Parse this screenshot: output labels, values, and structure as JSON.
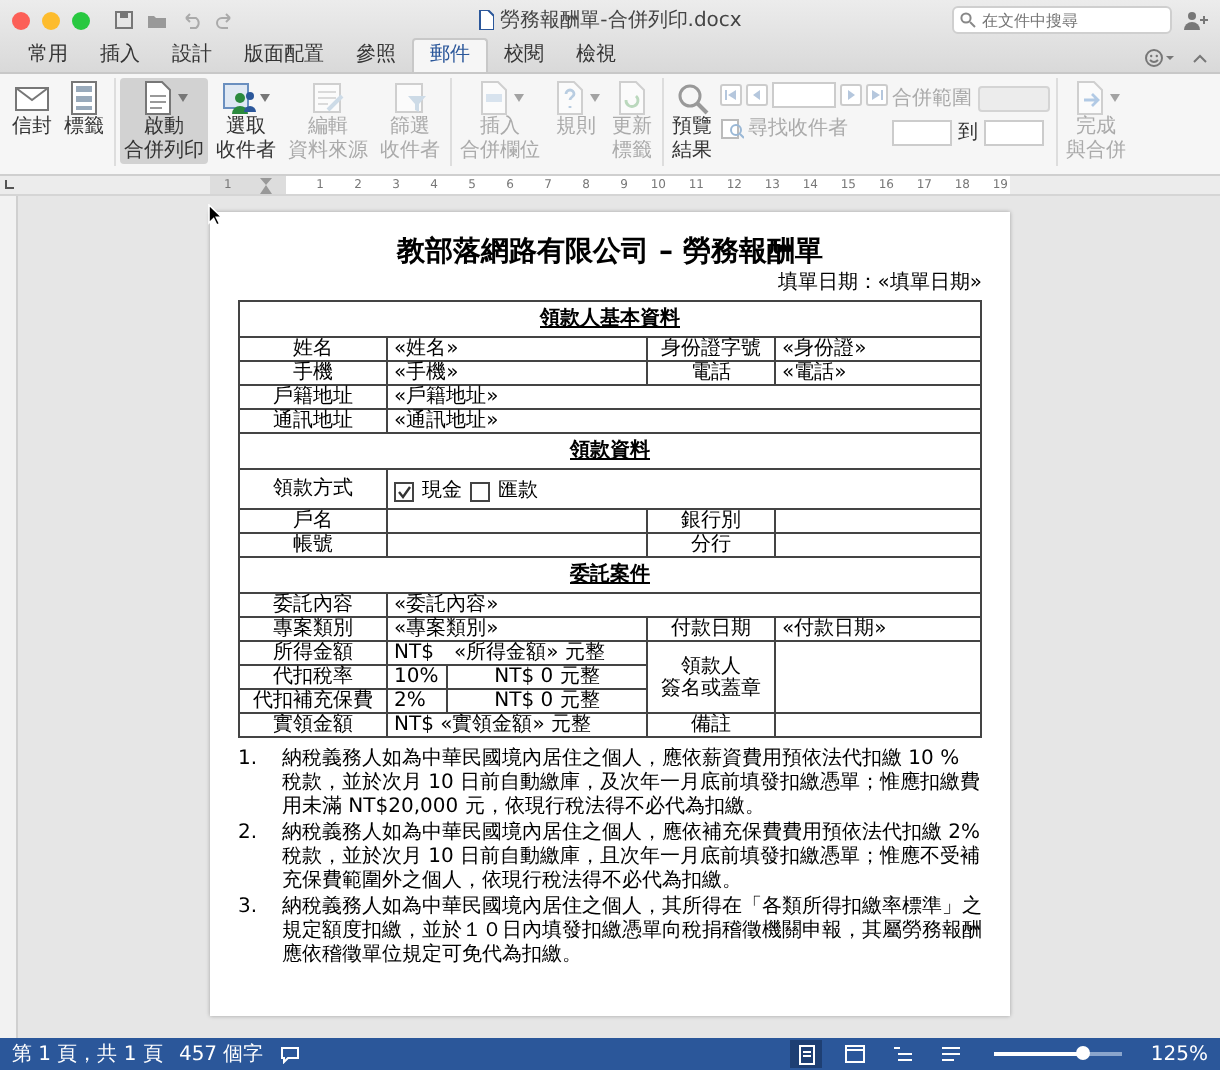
{
  "window": {
    "title": "勞務報酬單-合併列印.docx",
    "search": {
      "placeholder": "在文件中搜尋"
    }
  },
  "tabs": [
    {
      "label": "常用",
      "selected": false
    },
    {
      "label": "插入",
      "selected": false
    },
    {
      "label": "設計",
      "selected": false
    },
    {
      "label": "版面配置",
      "selected": false
    },
    {
      "label": "參照",
      "selected": false
    },
    {
      "label": "郵件",
      "selected": true
    },
    {
      "label": "校閱",
      "selected": false
    },
    {
      "label": "檢視",
      "selected": false
    }
  ],
  "ribbon": {
    "groups": [
      {
        "items": [
          {
            "kind": "button",
            "label": [
              "信封"
            ],
            "disabled": false,
            "highlighted": false,
            "dropdown": false
          },
          {
            "kind": "button",
            "label": [
              "標籤"
            ],
            "disabled": false,
            "highlighted": false,
            "dropdown": false
          }
        ]
      },
      {
        "items": [
          {
            "kind": "button",
            "label": [
              "啟動",
              "合併列印"
            ],
            "disabled": false,
            "highlighted": true,
            "dropdown": true
          },
          {
            "kind": "button",
            "label": [
              "選取",
              "收件者"
            ],
            "disabled": false,
            "highlighted": false,
            "dropdown": true
          },
          {
            "kind": "button",
            "label": [
              "編輯",
              "資料來源"
            ],
            "disabled": true,
            "highlighted": false,
            "dropdown": false
          },
          {
            "kind": "button",
            "label": [
              "篩選",
              "收件者"
            ],
            "disabled": true,
            "highlighted": false,
            "dropdown": false
          }
        ]
      },
      {
        "items": [
          {
            "kind": "button",
            "label": [
              "插入",
              "合併欄位"
            ],
            "disabled": true,
            "highlighted": false,
            "dropdown": true
          },
          {
            "kind": "button",
            "label": [
              "規則"
            ],
            "disabled": true,
            "highlighted": false,
            "dropdown": true
          },
          {
            "kind": "button",
            "label": [
              "更新",
              "標籤"
            ],
            "disabled": true,
            "highlighted": false,
            "dropdown": false
          }
        ]
      },
      {
        "items": [
          {
            "kind": "button",
            "label": [
              "預覽",
              "結果"
            ],
            "disabled": false,
            "highlighted": false,
            "dropdown": false
          },
          {
            "kind": "navigator",
            "disabled": true,
            "finder_label": "尋找收件者"
          },
          {
            "kind": "range",
            "label": "合併範圍",
            "to_label": "到",
            "disabled": true
          }
        ]
      },
      {
        "items": [
          {
            "kind": "button",
            "label": [
              "完成",
              "與合併"
            ],
            "disabled": true,
            "highlighted": false,
            "dropdown": true
          }
        ]
      }
    ]
  },
  "ruler": {
    "left_marks": [
      "1"
    ],
    "marks": [
      "1",
      "2",
      "3",
      "4",
      "5",
      "6",
      "7",
      "8",
      "9",
      "10",
      "11",
      "12",
      "13",
      "14",
      "15",
      "16",
      "17",
      "18",
      "19"
    ]
  },
  "document": {
    "title": "教部落網路有限公司 – 勞務報酬單",
    "date": "填單日期：«填單日期»",
    "sections": [
      {
        "title": "領款人基本資料",
        "rows": [
          {
            "kind": "pair",
            "label": "姓名",
            "value": "«姓名»",
            "label2": "身份證字號",
            "value2": "«身份證»"
          },
          {
            "kind": "pair",
            "label": "手機",
            "value": "«手機»",
            "label2": "電話",
            "value2": "«電話»"
          },
          {
            "kind": "wide",
            "label": "戶籍地址",
            "value": "«戶籍地址»"
          },
          {
            "kind": "wide",
            "label": "通訊地址",
            "value": "«通訊地址»"
          }
        ]
      },
      {
        "title": "領款資料",
        "rows": [
          {
            "kind": "payment",
            "label": "領款方式",
            "options": [
              {
                "label": "現金",
                "checked": true
              },
              {
                "label": "匯款",
                "checked": false
              }
            ]
          },
          {
            "kind": "pair",
            "label": "戶名",
            "label2": "銀行別"
          },
          {
            "kind": "pair",
            "label": "帳號",
            "label2": "分行"
          }
        ]
      },
      {
        "title": "委託案件",
        "rows": [
          {
            "kind": "wide",
            "label": "委託內容",
            "value": "«委託內容»"
          },
          {
            "kind": "pair",
            "label": "專案類別",
            "value": "«專案類別»",
            "label2": "付款日期",
            "value2": "«付款日期»"
          },
          {
            "kind": "amount",
            "label": "所得金額",
            "value": "NT$　«所得金額» 元整",
            "label2": [
              "領款人",
              "簽名或蓋章"
            ]
          },
          {
            "kind": "rate",
            "label": "代扣稅率",
            "rate": "10%",
            "value": "NT$ 0 元整"
          },
          {
            "kind": "rate",
            "label": "代扣補充保費",
            "rate": "2%",
            "value": "NT$ 0 元整"
          },
          {
            "kind": "pair",
            "label": "實領金額",
            "value": "NT$ «實領金額» 元整",
            "label2": "備註"
          }
        ]
      }
    ],
    "notes": [
      {
        "number": "1.",
        "text": "納稅義務人如為中華民國境內居住之個人，應依薪資費用預依法代扣繳 10 % 稅款，並於次月 10 日前自動繳庫，及次年一月底前填發扣繳憑單；惟應扣繳費用未滿 NT$20,000 元，依現行稅法得不必代為扣繳。"
      },
      {
        "number": "2.",
        "text": "納稅義務人如為中華民國境內居住之個人，應依補充保費費用預依法代扣繳 2% 稅款，並於次月 10 日前自動繳庫，且次年一月底前填發扣繳憑單；惟應不受補充保費範圍外之個人，依現行稅法得不必代為扣繳。"
      },
      {
        "number": "3.",
        "text": "納稅義務人如為中華民國境內居住之個人，其所得在「各類所得扣繳率標準」之規定額度扣繳，並於１０日內填發扣繳憑單向稅捐稽徵機關申報，其屬勞務報酬應依稽徵單位規定可免代為扣繳。"
      }
    ]
  },
  "status_bar": {
    "page": "第 1 頁，共 1 頁",
    "words": "457 個字",
    "views": [
      {
        "selected": true
      },
      {
        "selected": false
      },
      {
        "selected": false
      },
      {
        "selected": false
      }
    ],
    "zoom_slider": {
      "level": 0.68
    },
    "zoom": "125%"
  }
}
